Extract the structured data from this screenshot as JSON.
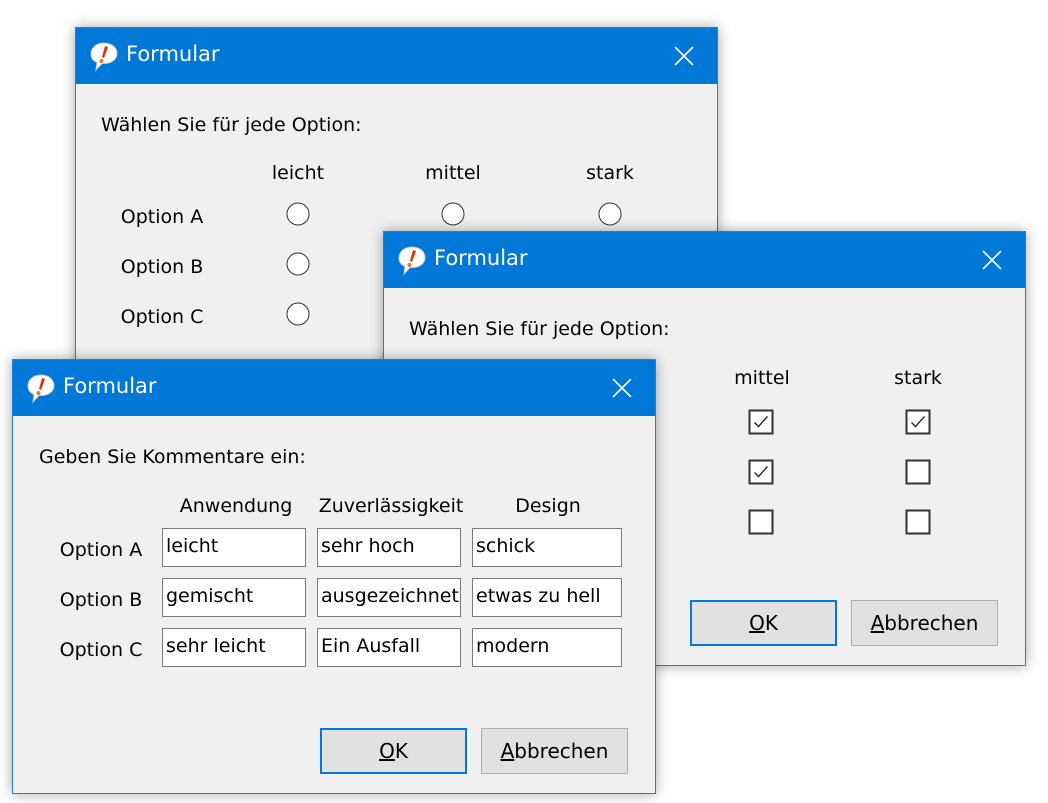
{
  "windows": [
    {
      "title": "Formular",
      "prompt": "Wählen Sie für jede Option:",
      "columns": [
        "leicht",
        "mittel",
        "stark"
      ],
      "rows": [
        "Option A",
        "Option B",
        "Option C"
      ]
    },
    {
      "title": "Formular",
      "prompt": "Wählen Sie für jede Option:",
      "columns": [
        "mittel",
        "stark"
      ],
      "checks": [
        [
          true,
          true
        ],
        [
          true,
          false
        ],
        [
          false,
          false
        ]
      ],
      "ok_hotkey": "O",
      "ok_rest": "K",
      "cancel_hotkey": "A",
      "cancel_rest": "bbrechen"
    },
    {
      "title": "Formular",
      "prompt": "Geben Sie Kommentare ein:",
      "columns": [
        "Anwendung",
        "Zuverlässigkeit",
        "Design"
      ],
      "rows": [
        {
          "label": "Option A",
          "values": [
            "leicht",
            "sehr hoch",
            "schick"
          ]
        },
        {
          "label": "Option B",
          "values": [
            "gemischt",
            "ausgezeichnet",
            "etwas zu hell"
          ]
        },
        {
          "label": "Option C",
          "values": [
            "sehr leicht",
            "Ein Ausfall",
            "modern"
          ]
        }
      ],
      "ok_hotkey": "O",
      "ok_rest": "K",
      "cancel_hotkey": "A",
      "cancel_rest": "bbrechen"
    }
  ],
  "colors": {
    "titlebar": "#0078d7",
    "dialog": "#f0f0f0"
  },
  "icons": {
    "app": "speech-bubble-exclamation-icon",
    "close": "close-icon"
  }
}
